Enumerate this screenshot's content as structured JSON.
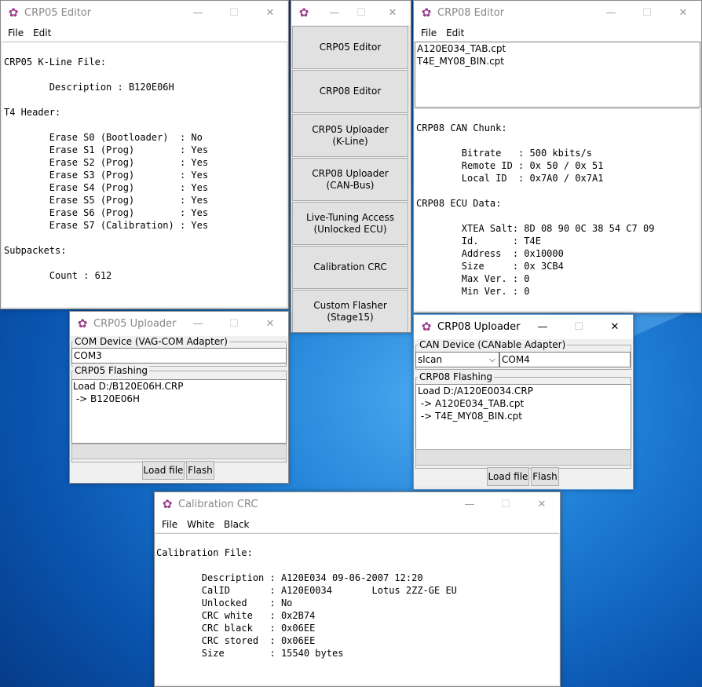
{
  "crp05_editor": {
    "title": "CRP05 Editor",
    "menu": [
      "File",
      "Edit"
    ],
    "lines": [
      "CRP05 K-Line File:",
      "",
      "        Description : B120E06H",
      "",
      "T4 Header:",
      "",
      "        Erase S0 (Bootloader)  : No",
      "        Erase S1 (Prog)        : Yes",
      "        Erase S2 (Prog)        : Yes",
      "        Erase S3 (Prog)        : Yes",
      "        Erase S4 (Prog)        : Yes",
      "        Erase S5 (Prog)        : Yes",
      "        Erase S6 (Prog)        : Yes",
      "        Erase S7 (Calibration) : Yes",
      "",
      "Subpackets:",
      "",
      "        Count : 612"
    ]
  },
  "launcher": {
    "buttons": [
      "CRP05 Editor",
      "CRP08 Editor",
      "CRP05 Uploader\n(K-Line)",
      "CRP08 Uploader\n(CAN-Bus)",
      "Live-Tuning Access\n(Unlocked ECU)",
      "Calibration CRC",
      "Custom Flasher\n(Stage15)"
    ]
  },
  "crp08_editor": {
    "title": "CRP08 Editor",
    "menu": [
      "File",
      "Edit"
    ],
    "files": [
      "A120E034_TAB.cpt",
      "T4E_MY08_BIN.cpt"
    ],
    "lines": [
      "CRP08 CAN Chunk:",
      "",
      "        Bitrate   : 500 kbits/s",
      "        Remote ID : 0x 50 / 0x 51",
      "        Local ID  : 0x7A0 / 0x7A1",
      "",
      "CRP08 ECU Data:",
      "",
      "        XTEA Salt: 8D 08 90 0C 38 54 C7 09",
      "        Id.      : T4E",
      "        Address  : 0x10000",
      "        Size     : 0x 3CB4",
      "        Max Ver. : 0",
      "        Min Ver. : 0"
    ]
  },
  "crp05_uploader": {
    "title": "CRP05 Uploader",
    "com_group": "COM Device (VAG-COM Adapter)",
    "com_value": "COM3",
    "flash_group": "CRP05 Flashing",
    "log": [
      "Load D:/B120E06H.CRP",
      " -> B120E06H"
    ],
    "load_label": "Load file",
    "flash_label": "Flash"
  },
  "crp08_uploader": {
    "title": "CRP08 Uploader",
    "can_group": "CAN Device (CANable Adapter)",
    "driver_value": "slcan",
    "com_value": "COM4",
    "flash_group": "CRP08 Flashing",
    "log": [
      "Load D:/A120E0034.CRP",
      " -> A120E034_TAB.cpt",
      " -> T4E_MY08_BIN.cpt"
    ],
    "load_label": "Load file",
    "flash_label": "Flash"
  },
  "calibration_crc": {
    "title": "Calibration CRC",
    "menu": [
      "File",
      "White",
      "Black"
    ],
    "lines": [
      "Calibration File:",
      "",
      "        Description : A120E034 09-06-2007 12:20",
      "        CalID       : A120E0034       Lotus 2ZZ-GE EU",
      "        Unlocked    : No",
      "        CRC white   : 0x2B74",
      "        CRC black   : 0x06EE",
      "        CRC stored  : 0x06EE",
      "        Size        : 15540 bytes"
    ]
  }
}
